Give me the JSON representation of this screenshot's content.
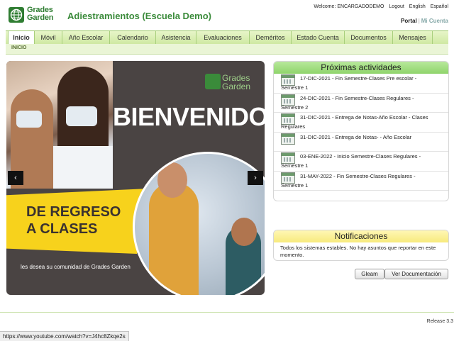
{
  "header": {
    "logo_text_1": "Grades",
    "logo_text_2": "Garden",
    "title": "Adiestramientos (Escuela Demo)",
    "welcome": "Welcome: ENCARGADODEMO",
    "logout": "Logout",
    "lang_english": "English",
    "lang_spanish": "Español",
    "portal": "Portal",
    "separator": "|",
    "mi_cuenta": "Mi Cuenta"
  },
  "nav": {
    "items": [
      {
        "label": "Inicio"
      },
      {
        "label": "Móvil"
      },
      {
        "label": "Año Escolar"
      },
      {
        "label": "Calendario"
      },
      {
        "label": "Asistencia"
      },
      {
        "label": "Evaluaciones"
      },
      {
        "label": "Deméritos"
      },
      {
        "label": "Estado Cuenta"
      },
      {
        "label": "Documentos"
      },
      {
        "label": "Mensajes"
      }
    ],
    "breadcrumb": "INICIO"
  },
  "carousel": {
    "logo_line_1": "Grades",
    "logo_line_2": "Garden",
    "heading": "BIENVENIDOS",
    "subheading_1": "DE REGRESO",
    "subheading_2": "A CLASES",
    "tagline": "les desea su comunidad de Grades Garden",
    "prev_label": "‹",
    "next_label": "›"
  },
  "activities": {
    "title": "Próximas actividades",
    "items": [
      {
        "line1": "17-DIC-2021 - Fin Semestre-Clases Pre escolar -",
        "line2": "Semestre 1"
      },
      {
        "line1": "24-DIC-2021 - Fin Semestre-Clases Regulares -",
        "line2": "Semestre 2"
      },
      {
        "line1": "31-DIC-2021 - Entrega de Notas-Año Escolar - Clases",
        "line2": "Regulares"
      },
      {
        "line1": "31-DIC-2021 - Entrega de Notas- - Año Escolar",
        "line2": ""
      },
      {
        "line1": "03-ENE-2022 - Inicio Semestre-Clases Regulares -",
        "line2": "Semestre 1"
      },
      {
        "line1": "31-MAY-2022 - Fin Semestre-Clases Regulares -",
        "line2": "Semestre 1"
      }
    ]
  },
  "notifications": {
    "title": "Notificaciones",
    "text": "Todos los sistemas estables. No hay asuntos que reportar en este momento."
  },
  "buttons": {
    "gleam": "Gleam",
    "docs": "Ver Documentación"
  },
  "footer": {
    "release": "Release 3.3",
    "status_url": "https://www.youtube.com/watch?v=J4hc8Zkqe2s"
  }
}
